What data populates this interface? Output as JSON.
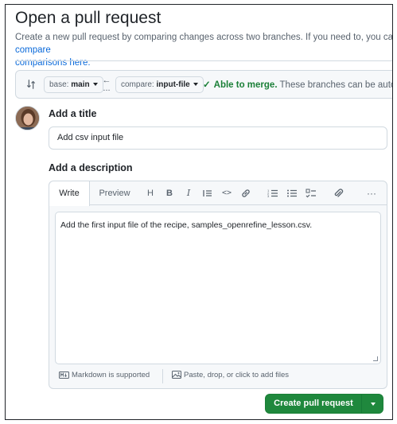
{
  "header": {
    "title": "Open a pull request",
    "subtitle_line1": "Create a new pull request by comparing changes across two branches. If you need to, you can also ",
    "subtitle_link1": "compare",
    "subtitle_link2": "comparisons here."
  },
  "compare": {
    "base_prefix": "base:",
    "base_branch": "main",
    "compare_prefix": "compare:",
    "compare_branch": "input-file",
    "arrow": "←",
    "arrow_dots": "...",
    "merge_status": "Able to merge.",
    "merge_note": "These branches can be automatically merged."
  },
  "form": {
    "title_label": "Add a title",
    "title_value": "Add csv input file",
    "description_label": "Add a description",
    "description_value": "Add the first input file of the recipe, samples_openrefine_lesson.csv."
  },
  "editor": {
    "tabs": [
      "Write",
      "Preview"
    ],
    "toolbar": {
      "heading": "H",
      "bold": "B",
      "italic": "I",
      "code": "<>",
      "more": "···"
    },
    "markdown_note": "Markdown is supported",
    "attach_note": "Paste, drop, or click to add files"
  },
  "actions": {
    "create_label": "Create pull request"
  },
  "colors": {
    "accent_link": "#0969da",
    "success": "#1a7f37",
    "primary_button": "#1f883d"
  }
}
